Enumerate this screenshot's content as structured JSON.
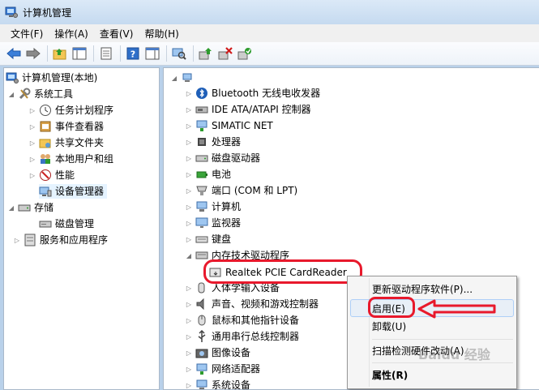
{
  "window": {
    "title": "计算机管理"
  },
  "menu": [
    "文件(F)",
    "操作(A)",
    "查看(V)",
    "帮助(H)"
  ],
  "left_tree": {
    "root": "计算机管理(本地)",
    "system_tools": "系统工具",
    "task_scheduler": "任务计划程序",
    "event_viewer": "事件查看器",
    "shared_folders": "共享文件夹",
    "local_users": "本地用户和组",
    "performance": "性能",
    "device_manager": "设备管理器",
    "storage": "存储",
    "disk_mgmt": "磁盘管理",
    "services": "服务和应用程序"
  },
  "devices": [
    "Bluetooth 无线电收发器",
    "IDE ATA/ATAPI 控制器",
    "SIMATIC NET",
    "处理器",
    "磁盘驱动器",
    "电池",
    "端口 (COM 和 LPT)",
    "计算机",
    "监视器",
    "键盘",
    "内存技术驱动程序",
    "Realtek PCIE CardReader",
    "人体学输入设备",
    "声音、视频和游戏控制器",
    "鼠标和其他指针设备",
    "通用串行总线控制器",
    "图像设备",
    "网络适配器",
    "系统设备"
  ],
  "context_menu": {
    "update": "更新驱动程序软件(P)...",
    "enable": "启用(E)",
    "uninstall": "卸载(U)",
    "scan": "扫描检测硬件改动(A)",
    "properties": "属性(R)"
  },
  "watermark": "Baidu 经验",
  "colors": {
    "annotation_red": "#e8192c",
    "selection": "#e5f3ff"
  }
}
